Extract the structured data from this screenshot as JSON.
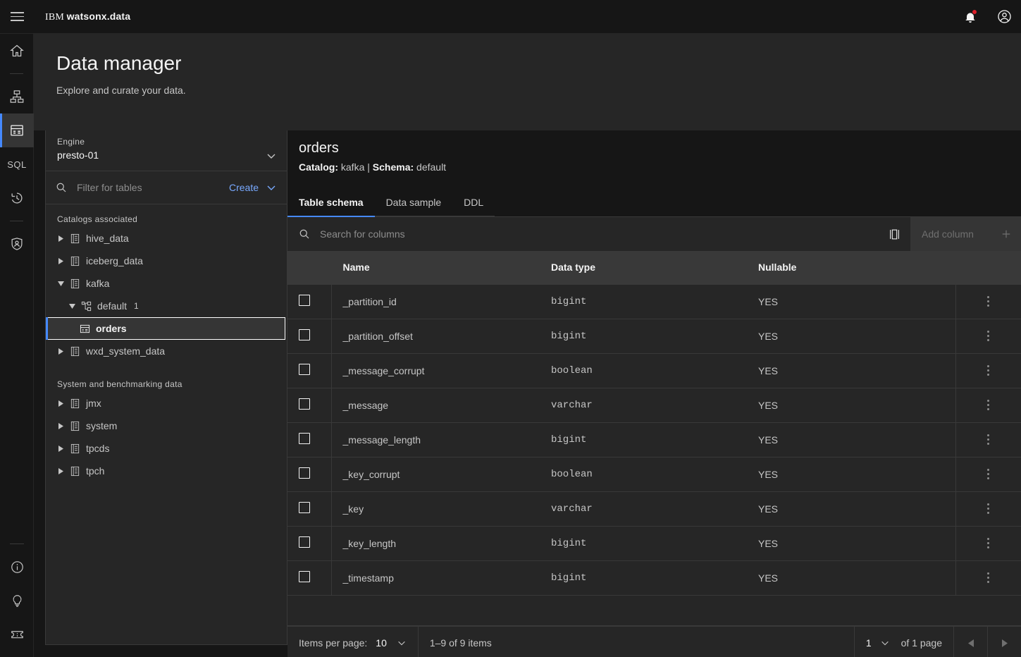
{
  "header": {
    "menu_icon": "hamburger-menu-icon",
    "brand_prefix": "IBM ",
    "brand_name": "watsonx.data",
    "notifications_icon": "notification-bell-icon",
    "account_icon": "user-avatar-icon"
  },
  "rail": {
    "items": [
      {
        "name": "home",
        "icon": "home-icon"
      },
      {
        "name": "infrastructure",
        "icon": "infrastructure-icon"
      },
      {
        "name": "data-manager",
        "icon": "data-manager-icon",
        "active": true
      },
      {
        "name": "sql",
        "icon": "sql-icon",
        "label": "SQL"
      },
      {
        "name": "query-history",
        "icon": "history-clock-icon"
      },
      {
        "name": "access-control",
        "icon": "access-control-icon"
      }
    ],
    "bottom_items": [
      {
        "name": "about",
        "icon": "info-icon"
      },
      {
        "name": "tips",
        "icon": "lightbulb-icon"
      },
      {
        "name": "support",
        "icon": "ticket-icon"
      }
    ]
  },
  "page": {
    "title": "Data manager",
    "subtitle": "Explore and curate your data."
  },
  "panel": {
    "engine": {
      "label": "Engine",
      "value": "presto-01",
      "chevron_icon": "chevron-down-icon"
    },
    "filter": {
      "search_icon": "search-icon",
      "placeholder": "Filter for tables",
      "value": "",
      "create_label": "Create",
      "create_chevron_icon": "chevron-down-icon"
    },
    "groups": [
      {
        "title": "Catalogs associated",
        "items": [
          {
            "label": "hive_data",
            "icon": "catalog-icon",
            "expanded": false,
            "level": 1
          },
          {
            "label": "iceberg_data",
            "icon": "catalog-icon",
            "expanded": false,
            "level": 1
          },
          {
            "label": "kafka",
            "icon": "catalog-icon",
            "expanded": true,
            "level": 1
          },
          {
            "label": "default",
            "count": "1",
            "icon": "schema-icon",
            "expanded": true,
            "level": 2
          },
          {
            "label": "orders",
            "icon": "table-icon",
            "selected": true,
            "level": 3
          },
          {
            "label": "wxd_system_data",
            "icon": "catalog-icon",
            "expanded": false,
            "level": 1
          }
        ]
      },
      {
        "title": "System and benchmarking data",
        "items": [
          {
            "label": "jmx",
            "icon": "catalog-icon",
            "expanded": false,
            "level": 1
          },
          {
            "label": "system",
            "icon": "catalog-icon",
            "expanded": false,
            "level": 1
          },
          {
            "label": "tpcds",
            "icon": "catalog-icon",
            "expanded": false,
            "level": 1
          },
          {
            "label": "tpch",
            "icon": "catalog-icon",
            "expanded": false,
            "level": 1
          }
        ]
      }
    ]
  },
  "detail": {
    "table_name": "orders",
    "meta": {
      "catalog_label": "Catalog:",
      "catalog_value": " kafka | ",
      "schema_label": "Schema:",
      "schema_value": " default"
    },
    "tabs": [
      {
        "label": "Table schema",
        "active": true
      },
      {
        "label": "Data sample",
        "active": false
      },
      {
        "label": "DDL",
        "active": false
      }
    ],
    "toolbar": {
      "search_icon": "search-icon",
      "search_placeholder": "Search for columns",
      "search_value": "",
      "column_settings_icon": "column-settings-icon",
      "add_column_label": "Add column",
      "add_column_icon": "plus-icon",
      "add_column_disabled": true
    },
    "table": {
      "headers": [
        "Name",
        "Data type",
        "Nullable"
      ],
      "rows": [
        {
          "name": "_partition_id",
          "type": "bigint",
          "nullable": "YES"
        },
        {
          "name": "_partition_offset",
          "type": "bigint",
          "nullable": "YES"
        },
        {
          "name": "_message_corrupt",
          "type": "boolean",
          "nullable": "YES"
        },
        {
          "name": "_message",
          "type": "varchar",
          "nullable": "YES"
        },
        {
          "name": "_message_length",
          "type": "bigint",
          "nullable": "YES"
        },
        {
          "name": "_key_corrupt",
          "type": "boolean",
          "nullable": "YES"
        },
        {
          "name": "_key",
          "type": "varchar",
          "nullable": "YES"
        },
        {
          "name": "_key_length",
          "type": "bigint",
          "nullable": "YES"
        },
        {
          "name": "_timestamp",
          "type": "bigint",
          "nullable": "YES"
        }
      ]
    },
    "pagination": {
      "items_per_page_label": "Items per page:",
      "items_per_page_value": "10",
      "range_text": "1–9 of 9 items",
      "page_value": "1",
      "of_pages_text": "of 1 page",
      "prev_icon": "caret-left-icon",
      "next_icon": "caret-right-icon"
    }
  },
  "colors": {
    "accent": "#4589ff",
    "link": "#78a9ff",
    "background": "#161616",
    "layer": "#262626",
    "layer_accent": "#393939",
    "danger": "#da1e28"
  }
}
